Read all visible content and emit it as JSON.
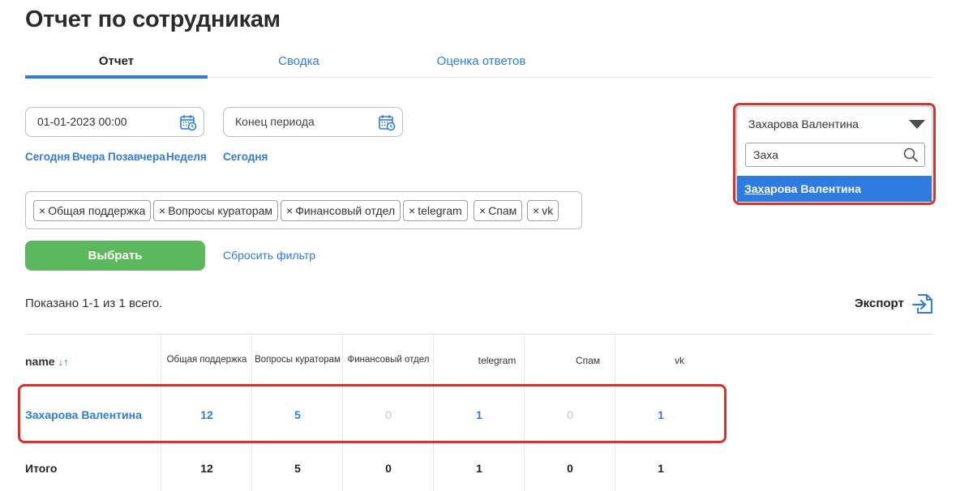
{
  "page": {
    "title": "Отчет по сотрудникам"
  },
  "tabs": [
    {
      "label": "Отчет",
      "active": true
    },
    {
      "label": "Сводка",
      "active": false
    },
    {
      "label": "Оценка ответов",
      "active": false
    }
  ],
  "period": {
    "start_value": "01-01-2023 00:00",
    "end_placeholder": "Конец периода",
    "start_quick": [
      "Сегодня",
      "Вчера",
      "Позавчера",
      "Неделя"
    ],
    "end_quick": [
      "Сегодня"
    ]
  },
  "tags": [
    "Общая поддержка",
    "Вопросы кураторам",
    "Финансовый отдел",
    "telegram",
    "Спам",
    "vk"
  ],
  "tag_remove_glyph": "×",
  "actions": {
    "select_label": "Выбрать",
    "reset_label": "Сбросить фильтр"
  },
  "employee_select": {
    "selected": "Захарова Валентина",
    "search_value": "Заха",
    "option_match": "Заха",
    "option_rest": "рова Валентина"
  },
  "summary": {
    "shown_text": "Показано 1-1 из 1 всего.",
    "export_label": "Экспорт"
  },
  "table": {
    "columns": [
      "name",
      "Общая поддержка",
      "Вопросы кураторам",
      "Финансовый отдел",
      "telegram",
      "Спам",
      "vk"
    ],
    "sort_glyph": "↓↑",
    "rows": [
      {
        "name": "Захарова Валентина",
        "values": [
          "12",
          "5",
          "0",
          "1",
          "0",
          "1"
        ]
      }
    ],
    "total": {
      "name": "Итого",
      "values": [
        "12",
        "5",
        "0",
        "1",
        "0",
        "1"
      ]
    }
  },
  "colors": {
    "accent": "#2f7be0",
    "success": "#5cb85c",
    "highlight": "#d7322c",
    "muted": "#c3c6cb"
  },
  "icons": [
    "calendar-icon",
    "chevron-down-icon",
    "search-icon",
    "export-icon",
    "sort-icon",
    "close-icon"
  ]
}
